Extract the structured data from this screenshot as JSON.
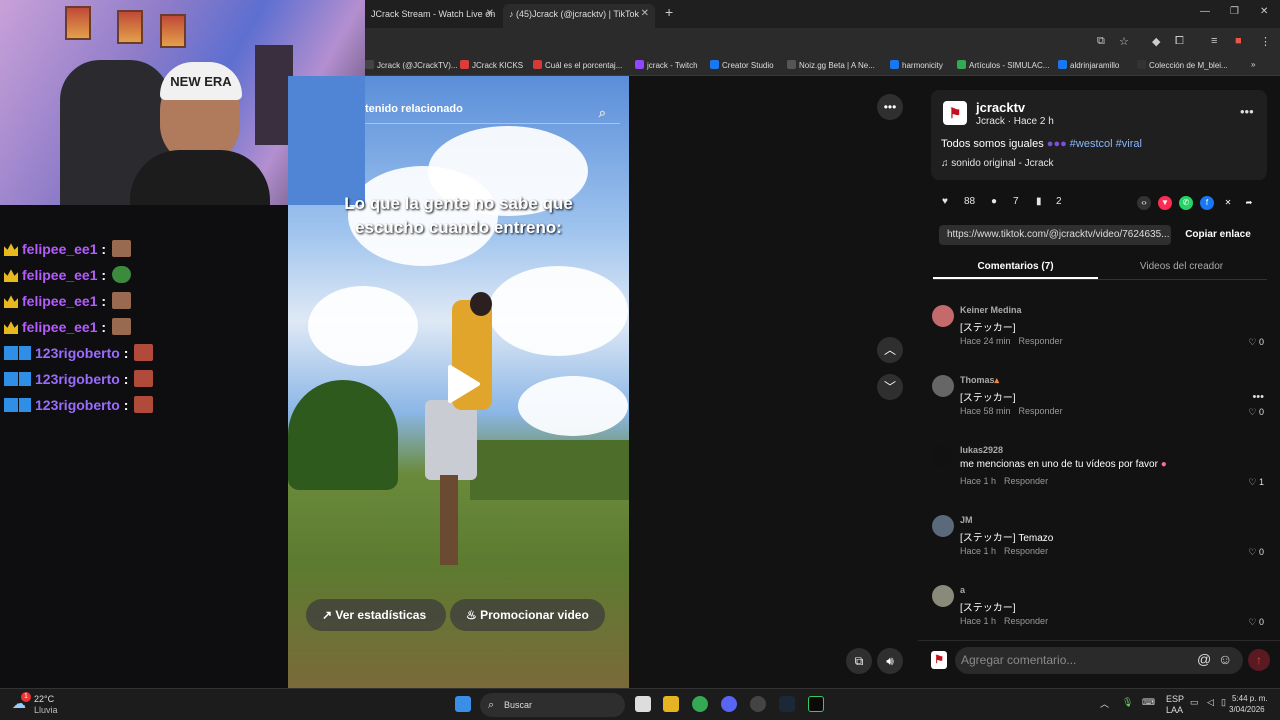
{
  "browser": {
    "tabs": [
      {
        "label": "JCrack Stream - Watch Live on"
      },
      {
        "label": "(45)Jcrack (@jcracktv) | TikTok"
      }
    ],
    "bookmarks": [
      {
        "label": "Jcrack (@JCrackTV)...",
        "color": "#444"
      },
      {
        "label": "JCrack KICKS",
        "color": "#e03b3b"
      },
      {
        "label": "Cuál es el porcentaj...",
        "color": "#d43a3a"
      },
      {
        "label": "jcrack - Twitch",
        "color": "#9146ff"
      },
      {
        "label": "Creator Studio",
        "color": "#1877f2"
      },
      {
        "label": "Noiz.gg Beta | A Ne...",
        "color": "#555"
      },
      {
        "label": "harmonicity",
        "color": "#1877f2"
      },
      {
        "label": "Artículos - SIMULAC...",
        "color": "#34a853"
      },
      {
        "label": "aldrinjaramillo",
        "color": "#1877f2"
      },
      {
        "label": "Colección de M_blei...",
        "color": "#333"
      }
    ]
  },
  "webcam": {
    "cap_text": "NEW ERA"
  },
  "chat": {
    "messages": [
      {
        "user": "felipee_ee1",
        "sep": ":"
      },
      {
        "user": "felipee_ee1",
        "sep": ":"
      },
      {
        "user": "felipee_ee1",
        "sep": ":"
      },
      {
        "user": "felipee_ee1",
        "sep": ":"
      },
      {
        "user": "123rigoberto",
        "sep": ":"
      },
      {
        "user": "123rigoberto",
        "sep": ":"
      },
      {
        "user": "123rigoberto",
        "sep": ":"
      }
    ]
  },
  "video": {
    "search_placeholder": "tenido relacionado",
    "caption": "Lo que la gente no sabe que\nescucho cuando entreno:",
    "stats_label": "Ver estadísticas",
    "promote_label": "Promocionar video"
  },
  "post": {
    "username": "jcracktv",
    "byline": "Jcrack · Hace 2 h",
    "description": "Todos somos iguales",
    "hashtags": "#westcol #viral",
    "sound": "sonido original - Jcrack",
    "likes": "88",
    "comments": "7",
    "saves": "2",
    "url": "https://www.tiktok.com/@jcracktv/video/7624635...",
    "copy_label": "Copiar enlace",
    "tab_comments": "Comentarios (7)",
    "tab_videos": "Videos del creador"
  },
  "comments": [
    {
      "name": "Keiner Medina",
      "text": "[ステッカー]",
      "time": "Hace 24 min",
      "reply": "Responder",
      "likes": "0",
      "avatar_color": "#c46a6a"
    },
    {
      "name": "Thomas",
      "text": "[ステッカー]",
      "time": "Hace 58 min",
      "reply": "Responder",
      "likes": "0",
      "avatar_color": "#666"
    },
    {
      "name": "lukas2928",
      "text": "me mencionas en uno de tu vídeos por favor",
      "time": "Hace 1 h",
      "reply": "Responder",
      "likes": "1",
      "avatar_color": "#111"
    },
    {
      "name": "JM",
      "text": "[ステッカー] Temazo",
      "time": "Hace 1 h",
      "reply": "Responder",
      "likes": "0",
      "avatar_color": "#5a6a7a"
    },
    {
      "name": "a",
      "text": "[ステッカー]",
      "time": "Hace 1 h",
      "reply": "Responder",
      "likes": "0",
      "avatar_color": "#8a8a7a"
    }
  ],
  "comment_input": {
    "placeholder": "Agregar comentario..."
  },
  "taskbar": {
    "weather_temp": "22°C",
    "weather_desc": "Lluvia",
    "weather_badge": "1",
    "search_placeholder": "Buscar",
    "lang": "ESP",
    "layout": "LAA",
    "time": "5:44 p. m.",
    "date": "3/04/2026"
  }
}
